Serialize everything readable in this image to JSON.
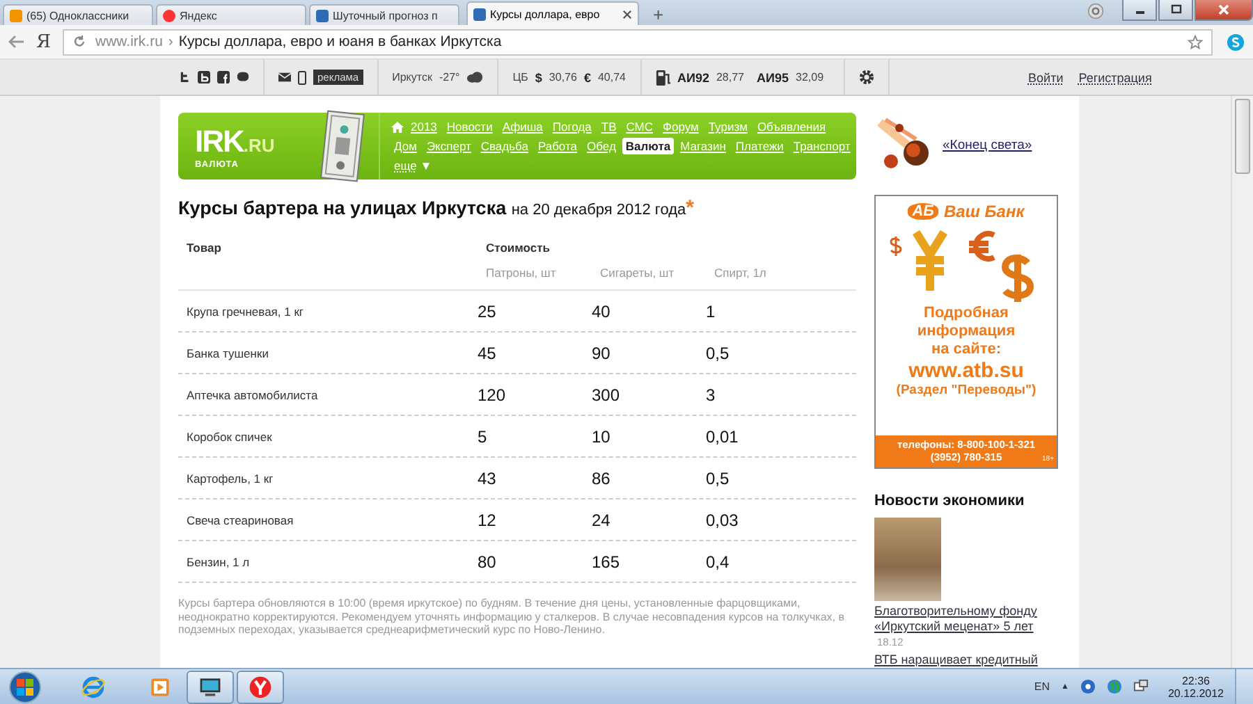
{
  "browser": {
    "tabs": [
      {
        "kind": "ok",
        "title": "(65) Одноклассники",
        "selected": false
      },
      {
        "kind": "yandex",
        "title": "Яндекс",
        "selected": false
      },
      {
        "kind": "irk",
        "title": "Шуточный прогноз п",
        "selected": false
      },
      {
        "kind": "irk",
        "title": "Курсы доллара, евро",
        "selected": true
      }
    ],
    "new_tab": "+",
    "address": {
      "logo": "Я",
      "host": "www.irk.ru",
      "separator": "›",
      "title": "Курсы доллара, евро и юаня в банках Иркутска"
    }
  },
  "site_bar": {
    "ad_label": "реклама",
    "city": "Иркутск",
    "temperature": "-27°",
    "cb": "ЦБ",
    "usd_sign": "$",
    "usd": "30,76",
    "eur_sign": "€",
    "eur": "40,74",
    "fuel": [
      {
        "name": "АИ92",
        "price": "28,77"
      },
      {
        "name": "АИ95",
        "price": "32,09"
      }
    ],
    "login": "Войти",
    "register": "Регистрация"
  },
  "header": {
    "logo": "IRK",
    "logo_suffix": ".RU",
    "logo_sub": "ВАЛЮТА",
    "nav": [
      {
        "label": "2013",
        "selected": false
      },
      {
        "label": "Новости",
        "selected": false
      },
      {
        "label": "Афиша",
        "selected": false
      },
      {
        "label": "Погода",
        "selected": false
      },
      {
        "label": "ТВ",
        "selected": false
      },
      {
        "label": "СМС",
        "selected": false
      },
      {
        "label": "Форум",
        "selected": false
      },
      {
        "label": "Туризм",
        "selected": false
      },
      {
        "label": "Объявления",
        "selected": false
      },
      {
        "label": "Дом",
        "selected": false
      },
      {
        "label": "Эксперт",
        "selected": false
      },
      {
        "label": "Свадьба",
        "selected": false
      },
      {
        "label": "Работа",
        "selected": false
      },
      {
        "label": "Обед",
        "selected": false
      },
      {
        "label": "Валюта",
        "selected": true
      },
      {
        "label": "Магазин",
        "selected": false
      },
      {
        "label": "Платежи",
        "selected": false
      },
      {
        "label": "Транспорт",
        "selected": false
      }
    ],
    "more": "еще",
    "more_arrow": "▼"
  },
  "article": {
    "title": "Курсы бартера на улицах Иркутска",
    "date": "на 20 декабря 2012 года",
    "mark": "*",
    "table": {
      "item_heading": "Товар",
      "group_heading": "Стоимость",
      "columns": [
        "Патроны, шт",
        "Сигареты, шт",
        "Спирт, 1л"
      ],
      "rows": [
        {
          "item": "Крупа гречневая, 1 кг",
          "values": [
            "25",
            "40",
            "1"
          ]
        },
        {
          "item": "Банка тушенки",
          "values": [
            "45",
            "90",
            "0,5"
          ]
        },
        {
          "item": "Аптечка автомобилиста",
          "values": [
            "120",
            "300",
            "3"
          ]
        },
        {
          "item": "Коробок спичек",
          "values": [
            "5",
            "10",
            "0,01"
          ]
        },
        {
          "item": "Картофель, 1 кг",
          "values": [
            "43",
            "86",
            "0,5"
          ]
        },
        {
          "item": "Свеча стеариновая",
          "values": [
            "12",
            "24",
            "0,03"
          ]
        },
        {
          "item": "Бензин, 1 л",
          "values": [
            "80",
            "165",
            "0,4"
          ]
        }
      ]
    },
    "note": "Курсы бартера обновляются в 10:00 (время иркутское) по будням. В течение дня цены, установленные фарцовщиками, неоднократно корректируются. Рекомендуем уточнять информацию у сталкеров. В случае несовпадения курсов на толкучках, в подземных переходах, указывается среднеарифметический курс по Ново-Ленино."
  },
  "sidebar": {
    "promo_link": "«Конец света»",
    "ad": {
      "logo": "АБ",
      "bank": "Ваш Банк",
      "lines": [
        "Подробная",
        "информация",
        "на сайте:"
      ],
      "url": "www.atb.su",
      "section": "(Раздел \"Переводы\")",
      "phones": [
        "телефоны: 8-800-100-1-321",
        "(3952) 780-315"
      ],
      "age": "18+"
    },
    "news_title": "Новости экономики",
    "news": [
      {
        "title": "Благотворительному фонду «Иркутский меценат» 5 лет",
        "time": "18.12"
      },
      {
        "title": "ВТБ наращивает кредитный"
      }
    ]
  },
  "taskbar": {
    "apps": [
      {
        "kind": "ie",
        "running": false
      },
      {
        "kind": "media",
        "running": false
      },
      {
        "kind": "monitor",
        "running": true
      },
      {
        "kind": "yandex",
        "running": true
      }
    ],
    "lang": "EN",
    "tray_arrow": "▲",
    "time": "22:36",
    "date": "20.12.2012"
  }
}
